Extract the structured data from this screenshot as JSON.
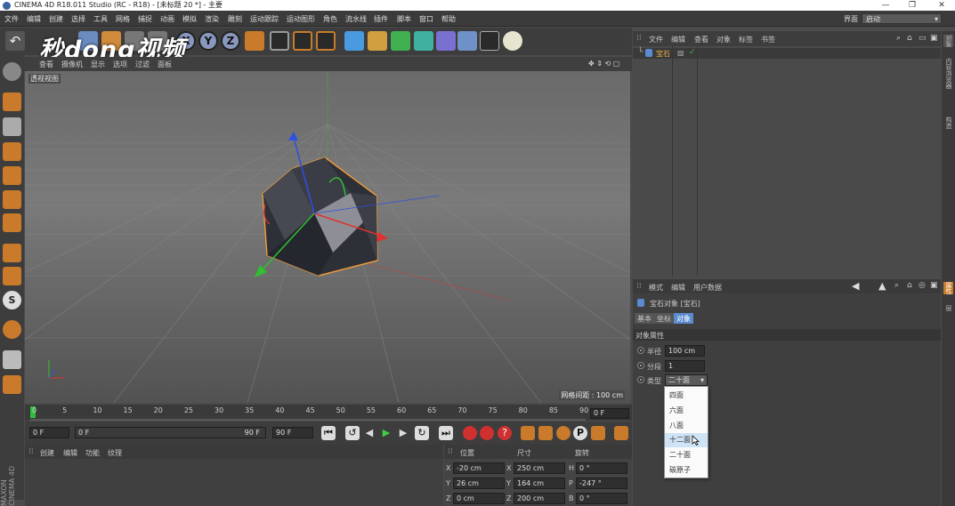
{
  "app": {
    "title": "CINEMA 4D R18.011 Studio (RC - R18) - [未标题 20 *] - 主要"
  },
  "menu": [
    "文件",
    "编辑",
    "创建",
    "选择",
    "工具",
    "网格",
    "捕捉",
    "动画",
    "模拟",
    "渲染",
    "雕刻",
    "运动跟踪",
    "运动图形",
    "角色",
    "流水线",
    "插件",
    "脚本",
    "窗口",
    "帮助"
  ],
  "layout": {
    "label": "界面",
    "value": "启动"
  },
  "watermark": "秒dong视频",
  "viewport": {
    "menu": [
      "查看",
      "摄像机",
      "显示",
      "选项",
      "过滤",
      "面板"
    ],
    "label": "透视视图",
    "grid_label": "网格间距 : 100 cm"
  },
  "timeline": {
    "ticks": [
      "0",
      "5",
      "10",
      "15",
      "20",
      "25",
      "30",
      "35",
      "40",
      "45",
      "50",
      "55",
      "60",
      "65",
      "70",
      "75",
      "80",
      "85",
      "90"
    ],
    "current_frame": "0 F"
  },
  "transport": {
    "start": "0 F",
    "range_start": "0 F",
    "range_end": "90 F",
    "end": "90 F"
  },
  "materials": {
    "menu": [
      "创建",
      "编辑",
      "功能",
      "纹理"
    ]
  },
  "coords": {
    "headers": [
      "位置",
      "尺寸",
      "旋转"
    ],
    "rows": [
      {
        "axis": "X",
        "pos": "-20 cm",
        "size_axis": "X",
        "size": "250 cm",
        "rot_axis": "H",
        "rot": "0 °"
      },
      {
        "axis": "Y",
        "pos": "26 cm",
        "size_axis": "Y",
        "size": "164 cm",
        "rot_axis": "P",
        "rot": "-247 °"
      },
      {
        "axis": "Z",
        "pos": "0 cm",
        "size_axis": "Z",
        "size": "200 cm",
        "rot_axis": "B",
        "rot": "0 °"
      }
    ]
  },
  "object_manager": {
    "menu": [
      "文件",
      "编辑",
      "查看",
      "对象",
      "标签",
      "书签"
    ],
    "object": "宝石"
  },
  "attributes": {
    "menu": [
      "模式",
      "编辑",
      "用户数据"
    ],
    "object_title": "宝石对象 [宝石]",
    "tabs": [
      "基本",
      "坐标",
      "对象"
    ],
    "section": "对象属性",
    "fields": [
      {
        "label": "半径",
        "value": "100 cm"
      },
      {
        "label": "分段",
        "value": "1"
      },
      {
        "label": "类型",
        "value": "二十面"
      }
    ],
    "dropdown": [
      "四面",
      "六面",
      "八面",
      "十二面",
      "二十面",
      "碳原子"
    ],
    "highlighted": "十二面"
  },
  "right_tabs": [
    "对象",
    "内容浏览器",
    "构造",
    "属性",
    "层"
  ],
  "brand": "MAXON CINEMA 4D",
  "colors": {
    "accent": "#5a8ad0",
    "object_outline": "#e89a3c",
    "axis_x": "#e03030",
    "axis_y": "#30c030",
    "axis_z": "#3050e0"
  }
}
